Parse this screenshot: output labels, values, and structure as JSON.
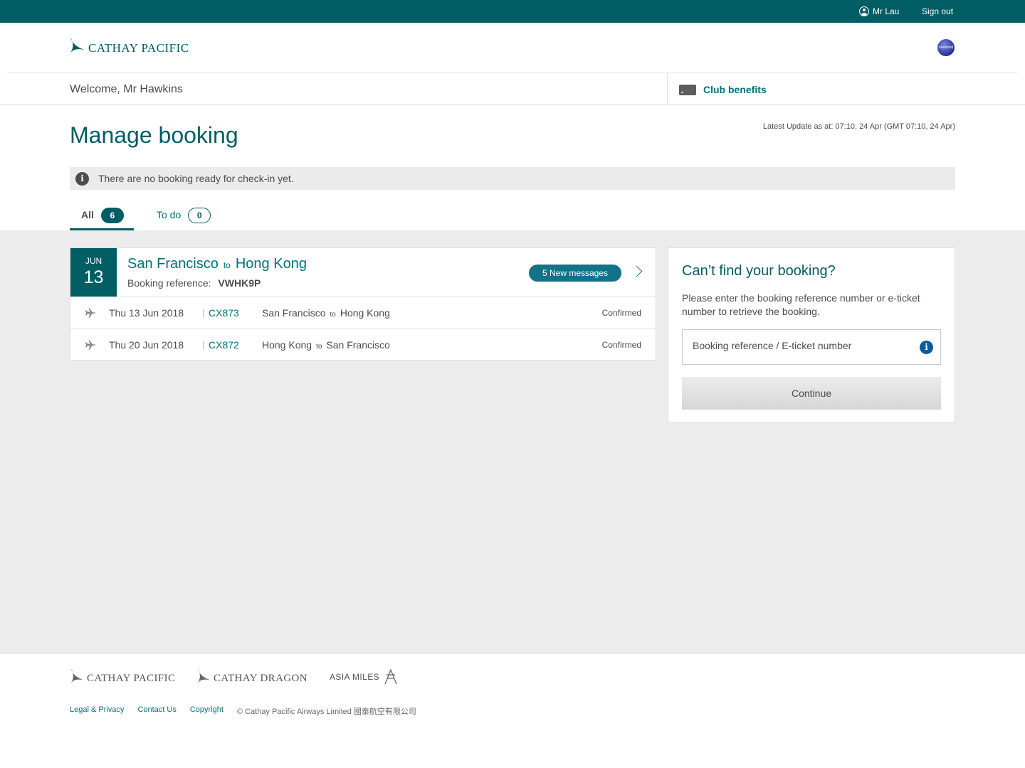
{
  "topbar": {
    "user_name": "Mr Lau",
    "sign_out": "Sign out"
  },
  "brand": {
    "logo_text": "CATHAY PACIFIC",
    "alliance_badge": "oneworld"
  },
  "welcome": {
    "text": "Welcome, Mr Hawkins",
    "club_benefits": "Club benefits"
  },
  "page": {
    "title": "Manage booking",
    "latest_update": "Latest Update as at: 07:10, 24 Apr (GMT 07:10, 24 Apr)"
  },
  "info_bar": {
    "message": "There are no booking ready for check-in yet."
  },
  "tabs": [
    {
      "label": "All",
      "count": "6"
    },
    {
      "label": "To do",
      "count": "0"
    }
  ],
  "booking": {
    "month": "JUN",
    "day": "13",
    "origin": "San Francisco",
    "to_word": "to",
    "destination": "Hong Kong",
    "ref_label": "Booking reference:",
    "ref_code": "VWHK9P",
    "new_messages": "5 New messages",
    "segments": [
      {
        "date": "Thu 13 Jun 2018",
        "flight": "CX873",
        "from": "San Francisco",
        "to_word": "to",
        "to": "Hong Kong",
        "status": "Confirmed"
      },
      {
        "date": "Thu 20 Jun 2018",
        "flight": "CX872",
        "from": "Hong Kong",
        "to_word": "to",
        "to": "San Francisco",
        "status": "Confirmed"
      }
    ]
  },
  "find_booking": {
    "title": "Can’t find your booking?",
    "description": "Please enter the booking reference number or e-ticket number to retrieve the booking.",
    "input_placeholder": "Booking reference / E-ticket number",
    "button": "Continue"
  },
  "footer": {
    "logos": [
      "CATHAY PACIFIC",
      "CATHAY DRAGON",
      "ASIA MILES"
    ],
    "links": [
      "Legal & Privacy",
      "Contact Us",
      "Copyright"
    ],
    "copyright": "© Cathay Pacific Airways Limited 國泰航空有限公司"
  },
  "colors": {
    "brand_teal": "#005d63",
    "link_teal": "#00727a",
    "badge_blue": "#127387",
    "page_gray": "#ebeceb"
  }
}
